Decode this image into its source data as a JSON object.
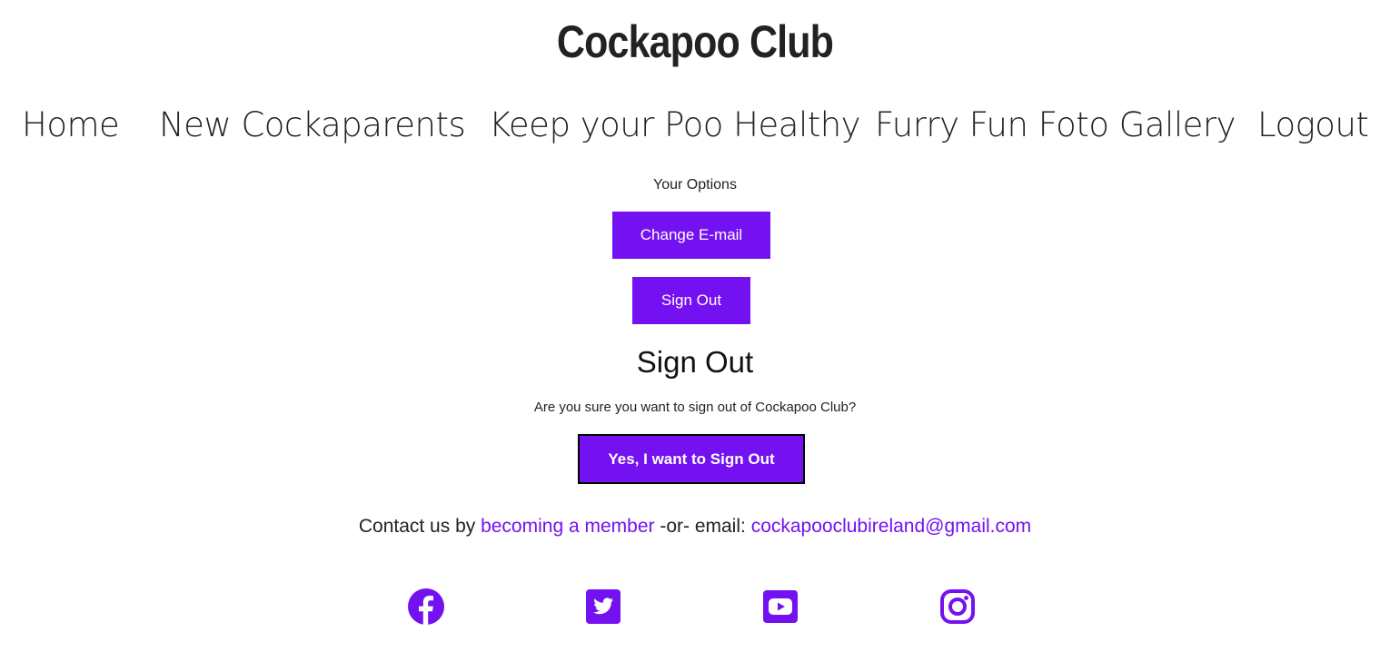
{
  "header": {
    "title": "Cockapoo Club"
  },
  "nav": {
    "items": [
      {
        "label": "Home"
      },
      {
        "label": "New Cockaparents"
      },
      {
        "label": "Keep your Poo Healthy"
      },
      {
        "label": "Furry Fun Foto Gallery"
      },
      {
        "label": "Logout"
      }
    ]
  },
  "options": {
    "label": "Your Options",
    "change_email_label": "Change E-mail",
    "sign_out_label": "Sign Out"
  },
  "signout": {
    "heading": "Sign Out",
    "question": "Are you sure you want to sign out of Cockapoo Club?",
    "confirm_label": "Yes, I want to Sign Out"
  },
  "footer": {
    "contact_prefix": "Contact us by ",
    "member_link": "becoming a member",
    "contact_middle": " -or- email: ",
    "email": "cockapooclubireland@gmail.com",
    "social": [
      {
        "icon": "facebook-icon"
      },
      {
        "icon": "twitter-icon"
      },
      {
        "icon": "youtube-icon"
      },
      {
        "icon": "instagram-icon"
      }
    ]
  },
  "colors": {
    "accent": "#7411f0",
    "text": "#222222",
    "background": "#ffffff"
  }
}
